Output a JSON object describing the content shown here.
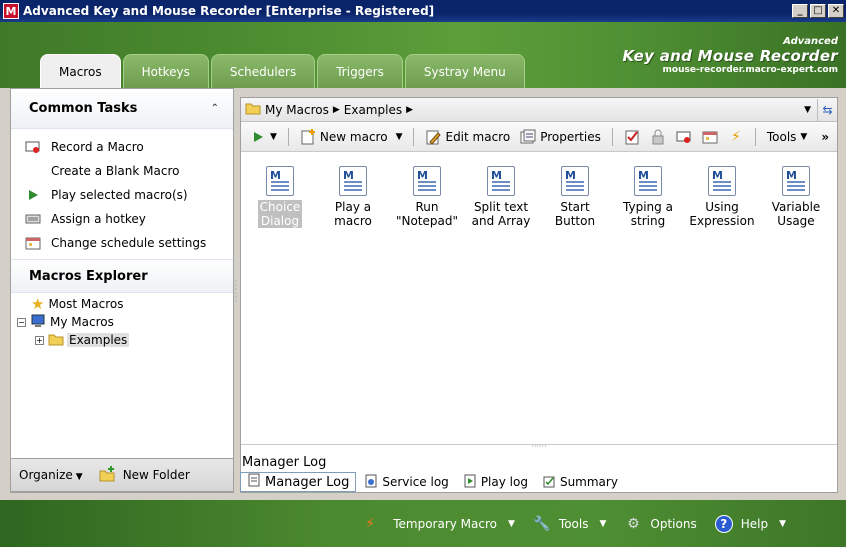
{
  "window": {
    "title": "Advanced Key and Mouse Recorder [Enterprise - Registered]",
    "app_icon_letter": "M",
    "minimize": "_",
    "maximize": "□",
    "close": "✕"
  },
  "brand": {
    "small": "Advanced",
    "big": "Key and Mouse Recorder",
    "url": "mouse-recorder.macro-expert.com"
  },
  "tabs": [
    {
      "label": "Macros",
      "active": true
    },
    {
      "label": "Hotkeys",
      "active": false
    },
    {
      "label": "Schedulers",
      "active": false
    },
    {
      "label": "Triggers",
      "active": false
    },
    {
      "label": "Systray Menu",
      "active": false
    }
  ],
  "common_tasks": {
    "title": "Common Tasks",
    "items": [
      {
        "label": "Record a Macro",
        "icon": "record-icon"
      },
      {
        "label": "Create a Blank Macro",
        "icon": ""
      },
      {
        "label": "Play selected macro(s)",
        "icon": "play-icon"
      },
      {
        "label": "Assign a hotkey",
        "icon": "keyboard-icon"
      },
      {
        "label": "Change schedule settings",
        "icon": "schedule-icon"
      }
    ]
  },
  "explorer": {
    "title": "Macros Explorer",
    "most": "Most Macros",
    "my": "My Macros",
    "examples": "Examples",
    "my_expander": "−",
    "examples_expander": "+"
  },
  "bottom_left": {
    "organize": "Organize",
    "new_folder": "New Folder"
  },
  "address": {
    "root": "My Macros",
    "current": "Examples"
  },
  "toolbar": {
    "new_macro": "New macro",
    "edit_macro": "Edit macro",
    "properties": "Properties",
    "tools": "Tools",
    "more": "»"
  },
  "macros": [
    {
      "line1": "Choice",
      "line2": "Dialog",
      "selected": true
    },
    {
      "line1": "Play a",
      "line2": "macro",
      "selected": false
    },
    {
      "line1": "Run",
      "line2": "\"Notepad\"",
      "selected": false
    },
    {
      "line1": "Split text",
      "line2": "and Array",
      "selected": false
    },
    {
      "line1": "Start",
      "line2": "Button",
      "selected": false
    },
    {
      "line1": "Typing a",
      "line2": "string",
      "selected": false
    },
    {
      "line1": "Using",
      "line2": "Expression",
      "selected": false
    },
    {
      "line1": "Variable",
      "line2": "Usage",
      "selected": false
    }
  ],
  "log": {
    "title": "Manager Log",
    "tabs": [
      "Manager Log",
      "Service log",
      "Play log",
      "Summary"
    ]
  },
  "statusbar": {
    "temporary_macro": "Temporary Macro",
    "tools": "Tools",
    "options": "Options",
    "help": "Help"
  },
  "colors": {
    "titlebar": "#0a246a",
    "header_green": "#4d8c30",
    "accent_blue": "#1f4f9a"
  }
}
